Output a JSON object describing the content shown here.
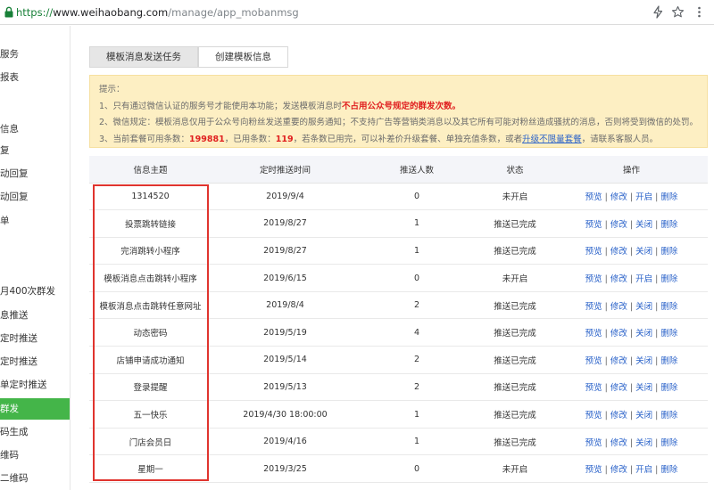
{
  "browser": {
    "url_protocol": "https://",
    "url_host": "www.weihaobang.com",
    "url_path": "/manage/app_mobanmsg"
  },
  "sidebar": {
    "items": [
      {
        "label": "服务"
      },
      {
        "label": "报表"
      },
      {
        "label": "信息"
      },
      {
        "label": "复"
      },
      {
        "label": "动回复"
      },
      {
        "label": "动回复"
      },
      {
        "label": "单"
      },
      {
        "label": "月400次群发"
      },
      {
        "label": "息推送"
      },
      {
        "label": "定时推送"
      },
      {
        "label": "定时推送"
      },
      {
        "label": "单定时推送"
      },
      {
        "label": "群发"
      },
      {
        "label": "码生成"
      },
      {
        "label": "维码"
      },
      {
        "label": "二维码"
      }
    ],
    "active_index": 12
  },
  "tabs": [
    {
      "label": "模板消息发送任务"
    },
    {
      "label": "创建模板信息"
    }
  ],
  "notice": {
    "title": "提示：",
    "line1_prefix": "1、只有通过微信认证的服务号才能使用本功能；发送模板消息时",
    "line1_highlight": "不占用公众号规定的群发次数。",
    "line2": "2、微信规定：模板消息仅用于公众号向粉丝发送重要的服务通知；不支持广告等营销类消息以及其它所有可能对粉丝造成骚扰的消息，否则将受到微信的处罚。",
    "line3_a": "3、当前套餐可用条数：",
    "available": "199881",
    "line3_b": "，已用条数：",
    "used": "119",
    "line3_c": "，若条数已用完，可以补差价升级套餐、单独充值条数，或者",
    "upgrade_link": "升级不限量套餐",
    "line3_d": "，请联系客服人员。"
  },
  "table": {
    "headers": [
      "信息主题",
      "定时推送时间",
      "推送人数",
      "状态",
      "操作"
    ],
    "ops": [
      "预览",
      "修改",
      "关闭",
      "开启",
      "删除"
    ],
    "rows": [
      {
        "subject": "1314520",
        "time": "2019/9/4",
        "count": "0",
        "status": "未开启"
      },
      {
        "subject": "投票跳转链接",
        "time": "2019/8/27",
        "count": "1",
        "status": "推送已完成"
      },
      {
        "subject": "完消跳转小程序",
        "time": "2019/8/27",
        "count": "1",
        "status": "推送已完成"
      },
      {
        "subject": "模板消息点击跳转小程序",
        "time": "2019/6/15",
        "count": "0",
        "status": "未开启"
      },
      {
        "subject": "模板消息点击跳转任意网址",
        "time": "2019/8/4",
        "count": "2",
        "status": "推送已完成"
      },
      {
        "subject": "动态密码",
        "time": "2019/5/19",
        "count": "4",
        "status": "推送已完成"
      },
      {
        "subject": "店铺申请成功通知",
        "time": "2019/5/14",
        "count": "2",
        "status": "推送已完成"
      },
      {
        "subject": "登录提醒",
        "time": "2019/5/13",
        "count": "2",
        "status": "推送已完成"
      },
      {
        "subject": "五一快乐",
        "time": "2019/4/30 18:00:00",
        "count": "1",
        "status": "推送已完成"
      },
      {
        "subject": "门店会员日",
        "time": "2019/4/16",
        "count": "1",
        "status": "推送已完成"
      },
      {
        "subject": "星期一",
        "time": "2019/3/25",
        "count": "0",
        "status": "未开启"
      }
    ]
  },
  "colors": {
    "active_green": "#44b549",
    "status_off": "#e02020",
    "status_done": "#d6a21a",
    "link_blue": "#2a62c9",
    "annotation_red": "#e0342e"
  }
}
